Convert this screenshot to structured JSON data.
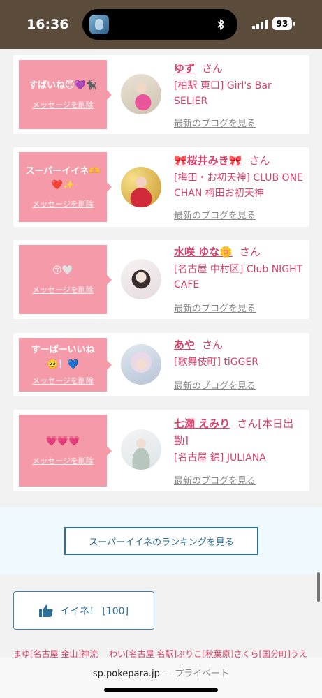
{
  "status": {
    "time": "16:36",
    "battery": "93"
  },
  "cards": [
    {
      "message": "すばいね😈💜🐈‍⬛",
      "delete_label": "メッセージを削除",
      "name": "ゆず",
      "san": "さん",
      "shop": "[柏駅 東口] Girl's Bar SELIER",
      "blog": "最新のブログを見る"
    },
    {
      "message": "スーパーイイネ🫶❤️✨",
      "delete_label": "メッセージを削除",
      "name": "🎀桜井みき🎀",
      "san": "さん",
      "shop": "[梅田・お初天神] CLUB ONE CHAN 梅田お初天神",
      "blog": "最新のブログを見る"
    },
    {
      "message": "😚🤍",
      "delete_label": "メッセージを削除",
      "name": "水咲 ゆな🌼",
      "san": "さん",
      "shop": "[名古屋 中村区] Club NIGHT CAFE",
      "blog": "最新のブログを見る"
    },
    {
      "message": "すーぱーいいね🥺！💙",
      "delete_label": "メッセージを削除",
      "name": "あや",
      "san": "さん",
      "shop": "[歌舞伎町] tiGGER",
      "blog": "最新のブログを見る"
    },
    {
      "message": "💗💗💗",
      "delete_label": "メッセージを削除",
      "name": "七瀬 えみり",
      "san": "さん[本日出勤]",
      "shop": "[名古屋 錦] JULIANA",
      "blog": "最新のブログを見る"
    }
  ],
  "ranking": {
    "button_label": "スーパーイイネのランキングを見る"
  },
  "like": {
    "label": "イイネ！ [100]"
  },
  "bottom_links": "まゆ[名古屋 金山]神流 　わい[名古屋 名駅]ぶりこ[秋葉原]さくら[国分町]うえ",
  "browser": {
    "domain": "sp.pokepara.jp",
    "separator": "—",
    "mode": "プライベート"
  }
}
